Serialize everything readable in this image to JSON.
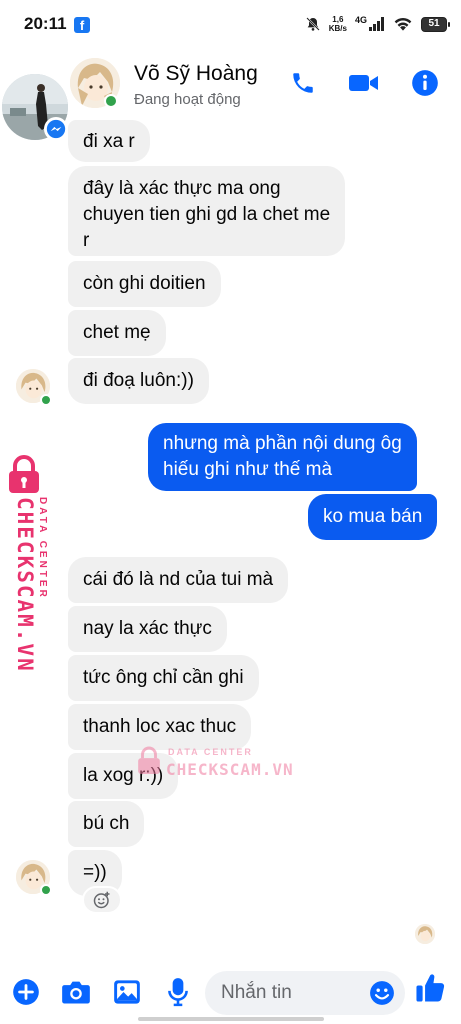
{
  "status_bar": {
    "time": "20:11",
    "fb_icon": "f",
    "speed_value": "1,6",
    "speed_unit": "KB/s",
    "network": "4G",
    "battery": "51"
  },
  "header": {
    "contact_name": "Võ Sỹ Hoàng",
    "status_text": "Đang hoạt động",
    "icons": [
      "back-icon",
      "phone-icon",
      "video-icon",
      "info-icon"
    ],
    "accent_color": "#0866ff"
  },
  "messages": [
    {
      "side": "in",
      "text": "đi xa r"
    },
    {
      "side": "in",
      "lines": [
        "đây là xác thực ma ong",
        "chuyen tien ghi gd la chet me",
        "r"
      ]
    },
    {
      "side": "in",
      "text": "còn ghi doitien"
    },
    {
      "side": "in",
      "text": "chet mẹ"
    },
    {
      "side": "in",
      "text": "đi đoạ luôn:))"
    },
    {
      "side": "out",
      "lines": [
        "nhưng mà phần nội dung ôg",
        "hiếu ghi như thế mà"
      ]
    },
    {
      "side": "out",
      "text": "ko mua bán"
    },
    {
      "side": "in",
      "text": "cái đó là nd của tui mà"
    },
    {
      "side": "in",
      "text": "nay la xác thực"
    },
    {
      "side": "in",
      "text": "tức ông chỉ cần ghi"
    },
    {
      "side": "in",
      "text": "thanh loc xac thuc"
    },
    {
      "side": "in",
      "text": "la xog r:))"
    },
    {
      "side": "in",
      "text": "bú ch"
    },
    {
      "side": "in",
      "text": "=))"
    }
  ],
  "watermark": {
    "side_top": "DATA CENTER",
    "side_main": "CHECKSCAM.VN",
    "center_top": "DATA CENTER",
    "center_main": "CHECKSCAM.VN",
    "color": "#e8336e"
  },
  "composer": {
    "placeholder": "Nhắn tin",
    "icons": [
      "plus-icon",
      "camera-icon",
      "gallery-icon",
      "mic-icon",
      "emoji-icon",
      "like-icon"
    ]
  },
  "colors": {
    "incoming_bubble": "#f0f0f0",
    "outgoing_bubble": "#0a5bf0",
    "online": "#31a24c"
  }
}
